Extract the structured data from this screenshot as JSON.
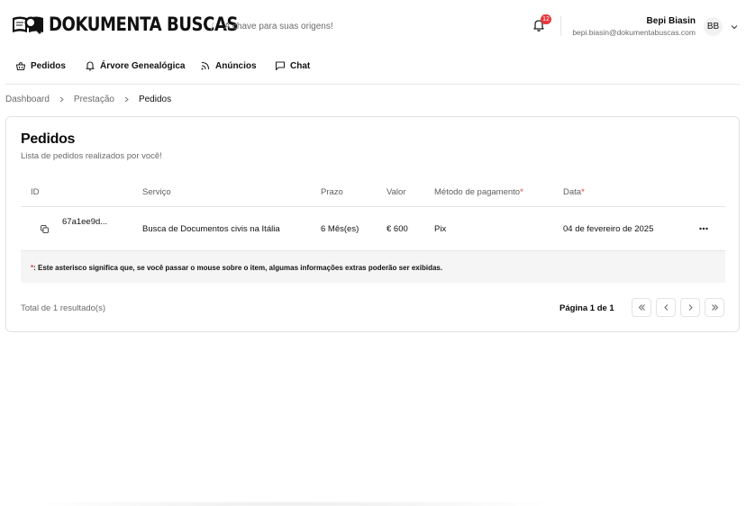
{
  "header": {
    "logo_text": "DOKUMENTA BUSCAS",
    "separator": "/",
    "tagline": "A chave para suas origens!",
    "notification_count": "12",
    "user": {
      "name": "Bepi Biasin",
      "email": "bepi.biasin@dokumentabuscas.com",
      "initials": "BB"
    }
  },
  "nav": {
    "items": [
      {
        "label": "Pedidos",
        "icon": "basket-icon"
      },
      {
        "label": "Árvore Genealógica",
        "icon": "bell-tree-icon"
      },
      {
        "label": "Anúncios",
        "icon": "rss-icon"
      },
      {
        "label": "Chat",
        "icon": "chat-icon"
      }
    ]
  },
  "breadcrumb": [
    "Dashboard",
    "Prestação",
    "Pedidos"
  ],
  "card": {
    "title": "Pedidos",
    "subtitle": "Lista de pedidos realizados por você!",
    "columns": [
      "ID",
      "Serviço",
      "Prazo",
      "Valor",
      "Método de pagamento",
      "Data"
    ],
    "required_mark": "*",
    "rows": [
      {
        "id": "67a1ee9d...",
        "servico": "Busca de Documentos civis na Itália",
        "prazo": "6 Mês(es)",
        "valor": "€ 600",
        "metodo": "Pix",
        "data": "04 de fevereiro de 2025"
      }
    ],
    "note": "*: Este asterisco significa que, se você passar o mouse sobre o item, algumas informações extras poderão ser exibidas.",
    "note_star": "*",
    "note_rest": ": Este asterisco significa que, se você passar o mouse sobre o item, algumas informações extras poderão ser exibidas.",
    "total": "Total de 1 resultado(s)",
    "page_info": "Página 1 de 1"
  },
  "colors": {
    "accent_red": "#e5383b",
    "border": "#e3e3e3",
    "muted_text": "#6b6b6b"
  }
}
